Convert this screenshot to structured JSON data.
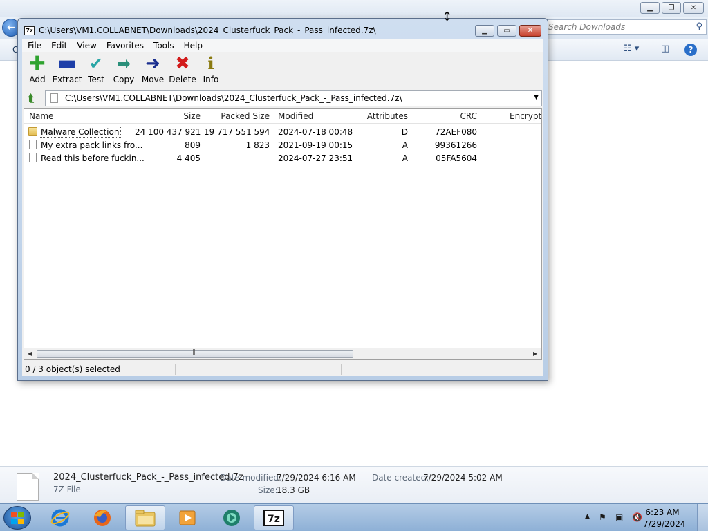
{
  "explorer": {
    "search_placeholder": "Search Downloads",
    "cmd_partial": "O",
    "details": {
      "filename": "2024_Clusterfuck_Pack_-_Pass_infected.7z",
      "filetype": "7Z File",
      "date_modified_label": "Date modified:",
      "date_modified_value": "7/29/2024 6:16 AM",
      "date_created_label": "Date created:",
      "date_created_value": "7/29/2024 5:02 AM",
      "size_label": "Size:",
      "size_value": "18.3 GB"
    }
  },
  "sevenzip": {
    "title": "C:\\Users\\VM1.COLLABNET\\Downloads\\2024_Clusterfuck_Pack_-_Pass_infected.7z\\",
    "app_icon_text": "7z",
    "menu": [
      "File",
      "Edit",
      "View",
      "Favorites",
      "Tools",
      "Help"
    ],
    "toolbar": [
      {
        "label": "Add",
        "icon": "plus-icon",
        "color": "#2fa32f"
      },
      {
        "label": "Extract",
        "icon": "minus-icon",
        "color": "#1e3fa8"
      },
      {
        "label": "Test",
        "icon": "check-icon",
        "color": "#2aa6a6"
      },
      {
        "label": "Copy",
        "icon": "double-arrow-icon",
        "color": "#2a8f7a"
      },
      {
        "label": "Move",
        "icon": "arrow-right-icon",
        "color": "#1b2f8f"
      },
      {
        "label": "Delete",
        "icon": "x-icon",
        "color": "#d21b1b"
      },
      {
        "label": "Info",
        "icon": "info-icon",
        "color": "#8a7a10"
      }
    ],
    "address": "C:\\Users\\VM1.COLLABNET\\Downloads\\2024_Clusterfuck_Pack_-_Pass_infected.7z\\",
    "columns": {
      "name": "Name",
      "size": "Size",
      "packed": "Packed Size",
      "modified": "Modified",
      "attributes": "Attributes",
      "crc": "CRC",
      "encrypted": "Encrypte"
    },
    "rows": [
      {
        "type": "folder",
        "name": "Malware Collection",
        "size": "24 100 437 921",
        "packed": "19 717 551 594",
        "modified": "2024-07-18 00:48",
        "attributes": "D",
        "crc": "72AEF080"
      },
      {
        "type": "file",
        "name": "My extra pack links fro...",
        "size": "809",
        "packed": "1 823",
        "modified": "2021-09-19 00:15",
        "attributes": "A",
        "crc": "99361266"
      },
      {
        "type": "file",
        "name": "Read this before fuckin...",
        "size": "4 405",
        "packed": "",
        "modified": "2024-07-27 23:51",
        "attributes": "A",
        "crc": "05FA5604"
      }
    ],
    "status": "0 / 3 object(s) selected"
  },
  "taskbar": {
    "time": "6:23 AM",
    "date": "7/29/2024",
    "apps": [
      "internet-explorer-icon",
      "firefox-icon",
      "file-explorer-icon",
      "media-player-icon",
      "app-icon",
      "7zip-icon"
    ]
  },
  "colors": {
    "accent": "#1f5fb8",
    "close_red": "#c7402c",
    "folder_yellow": "#e3be55"
  }
}
